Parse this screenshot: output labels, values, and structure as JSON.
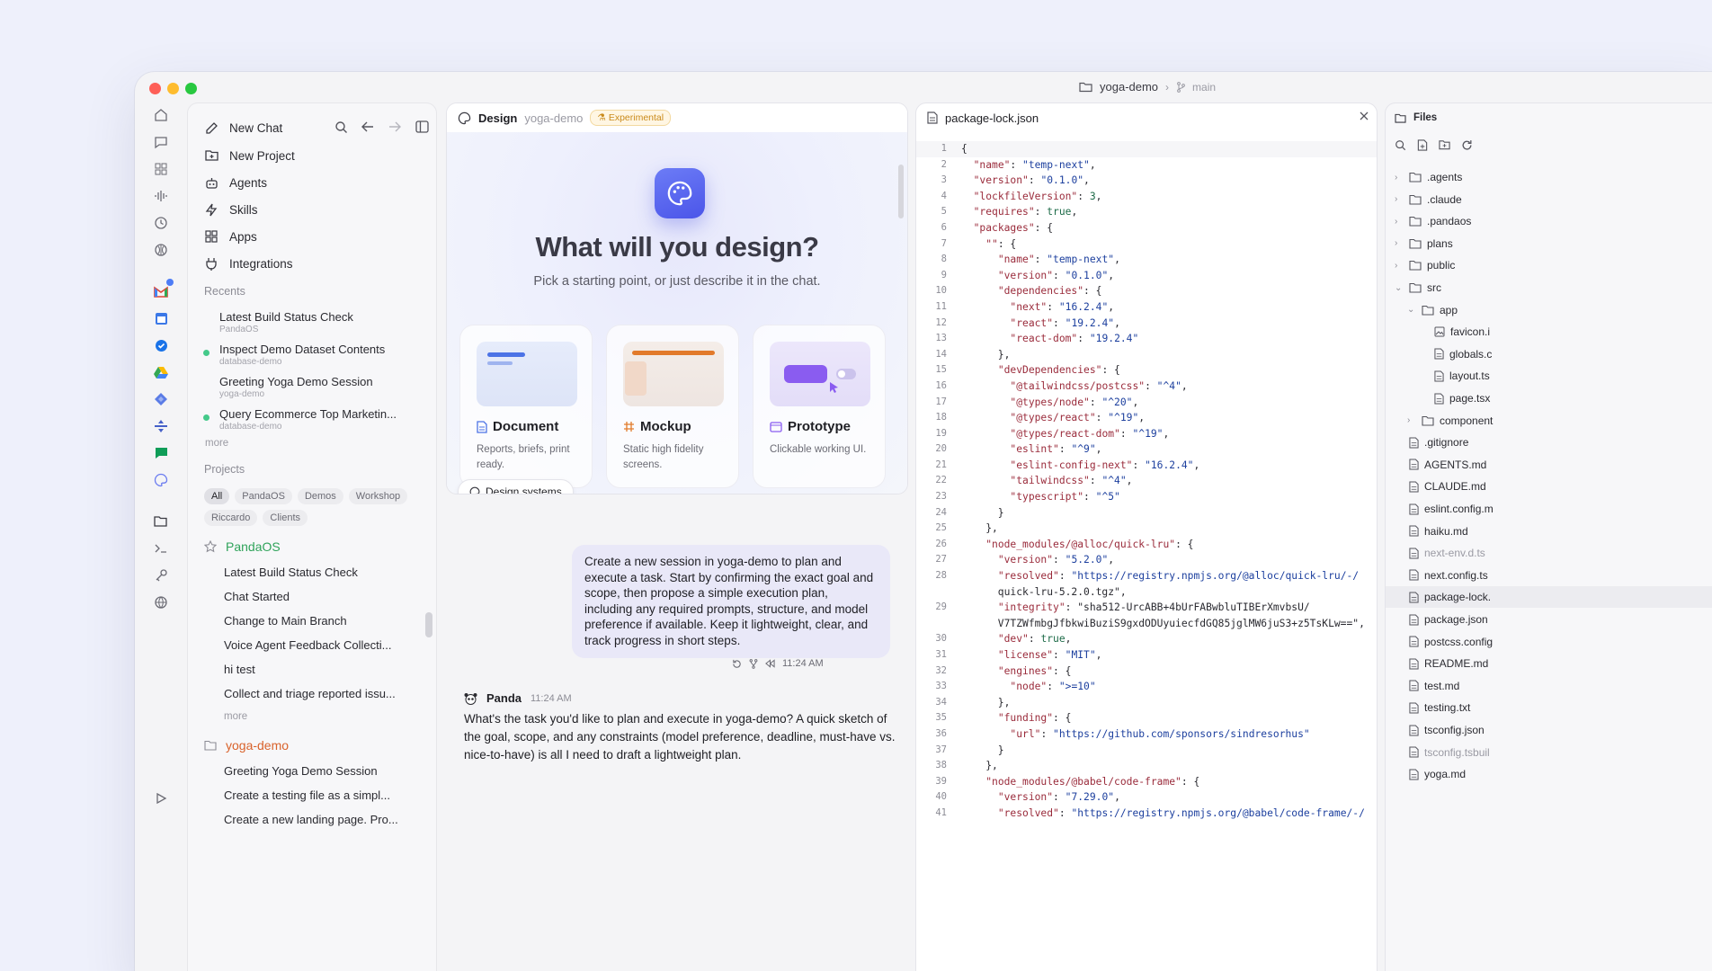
{
  "titlebar": {
    "repo": "yoga-demo",
    "branch": "main"
  },
  "sidebar": {
    "nav": [
      {
        "label": "New Chat",
        "icon": "edit-icon"
      },
      {
        "label": "New Project",
        "icon": "folder-plus-icon"
      },
      {
        "label": "Agents",
        "icon": "bot-icon"
      },
      {
        "label": "Skills",
        "icon": "bolt-icon"
      },
      {
        "label": "Apps",
        "icon": "grid-icon"
      },
      {
        "label": "Integrations",
        "icon": "plug-icon"
      }
    ],
    "recents_title": "Recents",
    "recents": [
      {
        "title": "Latest Build Status Check",
        "sub": "PandaOS",
        "active": false
      },
      {
        "title": "Inspect Demo Dataset Contents",
        "sub": "database-demo",
        "active": true
      },
      {
        "title": "Greeting Yoga Demo Session",
        "sub": "yoga-demo",
        "active": false
      },
      {
        "title": "Query Ecommerce Top Marketin...",
        "sub": "database-demo",
        "active": true
      }
    ],
    "more_label": "more",
    "projects_title": "Projects",
    "chips": [
      "All",
      "PandaOS",
      "Demos",
      "Workshop",
      "Riccardo",
      "Clients"
    ],
    "projects": [
      {
        "name": "PandaOS",
        "color": "#2fa35a",
        "items": [
          "Latest Build Status Check",
          "Chat Started",
          "Change to Main Branch",
          "Voice Agent Feedback Collecti...",
          "hi test",
          "Collect and triage reported issu..."
        ]
      },
      {
        "name": "yoga-demo",
        "color": "#d9622b",
        "items": [
          "Greeting Yoga Demo Session",
          "Create a testing file as a simpl...",
          "Create a new landing page. Pro..."
        ]
      }
    ]
  },
  "design": {
    "title": "Design",
    "repo": "yoga-demo",
    "badge": "Experimental",
    "heading": "What will you design?",
    "subheading": "Pick a starting point, or just describe it in the chat.",
    "cards": [
      {
        "title": "Document",
        "desc": "Reports, briefs, print ready.",
        "color": "#4c73e6"
      },
      {
        "title": "Mockup",
        "desc": "Static high fidelity screens.",
        "color": "#e27a2a"
      },
      {
        "title": "Prototype",
        "desc": "Clickable working UI.",
        "color": "#8a5cf0"
      }
    ],
    "design_systems": "Design systems"
  },
  "chat": {
    "user_message": "Create a new session in yoga-demo to plan and execute a task. Start by confirming the exact goal and scope, then propose a simple execution plan, including any required prompts, structure, and model preference if available. Keep it lightweight, clear, and track progress in short steps.",
    "user_time": "11:24 AM",
    "assistant_name": "Panda",
    "assistant_time": "11:24 AM",
    "assistant_message": "What's the task you'd like to plan and execute in yoga-demo? A quick sketch of the goal, scope, and any constraints (model preference, deadline, must-have vs. nice-to-have) is all I need to draft a lightweight plan."
  },
  "editor": {
    "filename": "package-lock.json",
    "lines": [
      {
        "n": "1",
        "t": "{"
      },
      {
        "n": "2",
        "t": "  \"name\": \"temp-next\","
      },
      {
        "n": "3",
        "t": "  \"version\": \"0.1.0\","
      },
      {
        "n": "4",
        "t": "  \"lockfileVersion\": 3,"
      },
      {
        "n": "5",
        "t": "  \"requires\": true,"
      },
      {
        "n": "6",
        "t": "  \"packages\": {"
      },
      {
        "n": "7",
        "t": "    \"\": {"
      },
      {
        "n": "8",
        "t": "      \"name\": \"temp-next\","
      },
      {
        "n": "9",
        "t": "      \"version\": \"0.1.0\","
      },
      {
        "n": "10",
        "t": "      \"dependencies\": {"
      },
      {
        "n": "11",
        "t": "        \"next\": \"16.2.4\","
      },
      {
        "n": "12",
        "t": "        \"react\": \"19.2.4\","
      },
      {
        "n": "13",
        "t": "        \"react-dom\": \"19.2.4\""
      },
      {
        "n": "14",
        "t": "      },"
      },
      {
        "n": "15",
        "t": "      \"devDependencies\": {"
      },
      {
        "n": "16",
        "t": "        \"@tailwindcss/postcss\": \"^4\","
      },
      {
        "n": "17",
        "t": "        \"@types/node\": \"^20\","
      },
      {
        "n": "18",
        "t": "        \"@types/react\": \"^19\","
      },
      {
        "n": "19",
        "t": "        \"@types/react-dom\": \"^19\","
      },
      {
        "n": "20",
        "t": "        \"eslint\": \"^9\","
      },
      {
        "n": "21",
        "t": "        \"eslint-config-next\": \"16.2.4\","
      },
      {
        "n": "22",
        "t": "        \"tailwindcss\": \"^4\","
      },
      {
        "n": "23",
        "t": "        \"typescript\": \"^5\""
      },
      {
        "n": "24",
        "t": "      }"
      },
      {
        "n": "25",
        "t": "    },"
      },
      {
        "n": "26",
        "t": "    \"node_modules/@alloc/quick-lru\": {"
      },
      {
        "n": "27",
        "t": "      \"version\": \"5.2.0\","
      },
      {
        "n": "28",
        "t": "      \"resolved\": \"https://registry.npmjs.org/@alloc/quick-lru/-/"
      },
      {
        "n": "",
        "t": "      quick-lru-5.2.0.tgz\","
      },
      {
        "n": "29",
        "t": "      \"integrity\": \"sha512-UrcABB+4bUrFABwbluTIBErXmvbsU/"
      },
      {
        "n": "",
        "t": "      V7TZWfmbgJfbkwiBuziS9gxdODUyuiecfdGQ85jglMW6juS3+z5TsKLw==\","
      },
      {
        "n": "30",
        "t": "      \"dev\": true,"
      },
      {
        "n": "31",
        "t": "      \"license\": \"MIT\","
      },
      {
        "n": "32",
        "t": "      \"engines\": {"
      },
      {
        "n": "33",
        "t": "        \"node\": \">=10\""
      },
      {
        "n": "34",
        "t": "      },"
      },
      {
        "n": "35",
        "t": "      \"funding\": {"
      },
      {
        "n": "36",
        "t": "        \"url\": \"https://github.com/sponsors/sindresorhus\""
      },
      {
        "n": "37",
        "t": "      }"
      },
      {
        "n": "38",
        "t": "    },"
      },
      {
        "n": "39",
        "t": "    \"node_modules/@babel/code-frame\": {"
      },
      {
        "n": "40",
        "t": "      \"version\": \"7.29.0\","
      },
      {
        "n": "41",
        "t": "      \"resolved\": \"https://registry.npmjs.org/@babel/code-frame/-/"
      }
    ]
  },
  "files": {
    "title": "Files",
    "tree": [
      {
        "name": ".agents",
        "type": "folder",
        "depth": 0,
        "chev": "›",
        "dim": false,
        "sel": false
      },
      {
        "name": ".claude",
        "type": "folder",
        "depth": 0,
        "chev": "›",
        "dim": false,
        "sel": false
      },
      {
        "name": ".pandaos",
        "type": "folder",
        "depth": 0,
        "chev": "›",
        "dim": false,
        "sel": false
      },
      {
        "name": "plans",
        "type": "folder",
        "depth": 0,
        "chev": "›",
        "dim": false,
        "sel": false
      },
      {
        "name": "public",
        "type": "folder",
        "depth": 0,
        "chev": "›",
        "dim": false,
        "sel": false
      },
      {
        "name": "src",
        "type": "folder",
        "depth": 0,
        "chev": "⌄",
        "dim": false,
        "sel": false
      },
      {
        "name": "app",
        "type": "folder",
        "depth": 1,
        "chev": "⌄",
        "dim": false,
        "sel": false
      },
      {
        "name": "favicon.i",
        "type": "image",
        "depth": 2,
        "chev": "",
        "dim": false,
        "sel": false
      },
      {
        "name": "globals.c",
        "type": "file",
        "depth": 2,
        "chev": "",
        "dim": false,
        "sel": false
      },
      {
        "name": "layout.ts",
        "type": "file",
        "depth": 2,
        "chev": "",
        "dim": false,
        "sel": false
      },
      {
        "name": "page.tsx",
        "type": "file",
        "depth": 2,
        "chev": "",
        "dim": false,
        "sel": false
      },
      {
        "name": "component",
        "type": "folder",
        "depth": 1,
        "chev": "›",
        "dim": false,
        "sel": false
      },
      {
        "name": ".gitignore",
        "type": "file",
        "depth": 0,
        "chev": "",
        "dim": false,
        "sel": false
      },
      {
        "name": "AGENTS.md",
        "type": "file",
        "depth": 0,
        "chev": "",
        "dim": false,
        "sel": false
      },
      {
        "name": "CLAUDE.md",
        "type": "file",
        "depth": 0,
        "chev": "",
        "dim": false,
        "sel": false
      },
      {
        "name": "eslint.config.m",
        "type": "file",
        "depth": 0,
        "chev": "",
        "dim": false,
        "sel": false
      },
      {
        "name": "haiku.md",
        "type": "file",
        "depth": 0,
        "chev": "",
        "dim": false,
        "sel": false
      },
      {
        "name": "next-env.d.ts",
        "type": "file",
        "depth": 0,
        "chev": "",
        "dim": true,
        "sel": false
      },
      {
        "name": "next.config.ts",
        "type": "file",
        "depth": 0,
        "chev": "",
        "dim": false,
        "sel": false
      },
      {
        "name": "package-lock.",
        "type": "file",
        "depth": 0,
        "chev": "",
        "dim": false,
        "sel": true
      },
      {
        "name": "package.json",
        "type": "file",
        "depth": 0,
        "chev": "",
        "dim": false,
        "sel": false
      },
      {
        "name": "postcss.config",
        "type": "file",
        "depth": 0,
        "chev": "",
        "dim": false,
        "sel": false
      },
      {
        "name": "README.md",
        "type": "file",
        "depth": 0,
        "chev": "",
        "dim": false,
        "sel": false
      },
      {
        "name": "test.md",
        "type": "file",
        "depth": 0,
        "chev": "",
        "dim": false,
        "sel": false
      },
      {
        "name": "testing.txt",
        "type": "file",
        "depth": 0,
        "chev": "",
        "dim": false,
        "sel": false
      },
      {
        "name": "tsconfig.json",
        "type": "file",
        "depth": 0,
        "chev": "",
        "dim": false,
        "sel": false
      },
      {
        "name": "tsconfig.tsbuil",
        "type": "file",
        "depth": 0,
        "chev": "",
        "dim": true,
        "sel": false
      },
      {
        "name": "yoga.md",
        "type": "file",
        "depth": 0,
        "chev": "",
        "dim": false,
        "sel": false
      }
    ]
  }
}
